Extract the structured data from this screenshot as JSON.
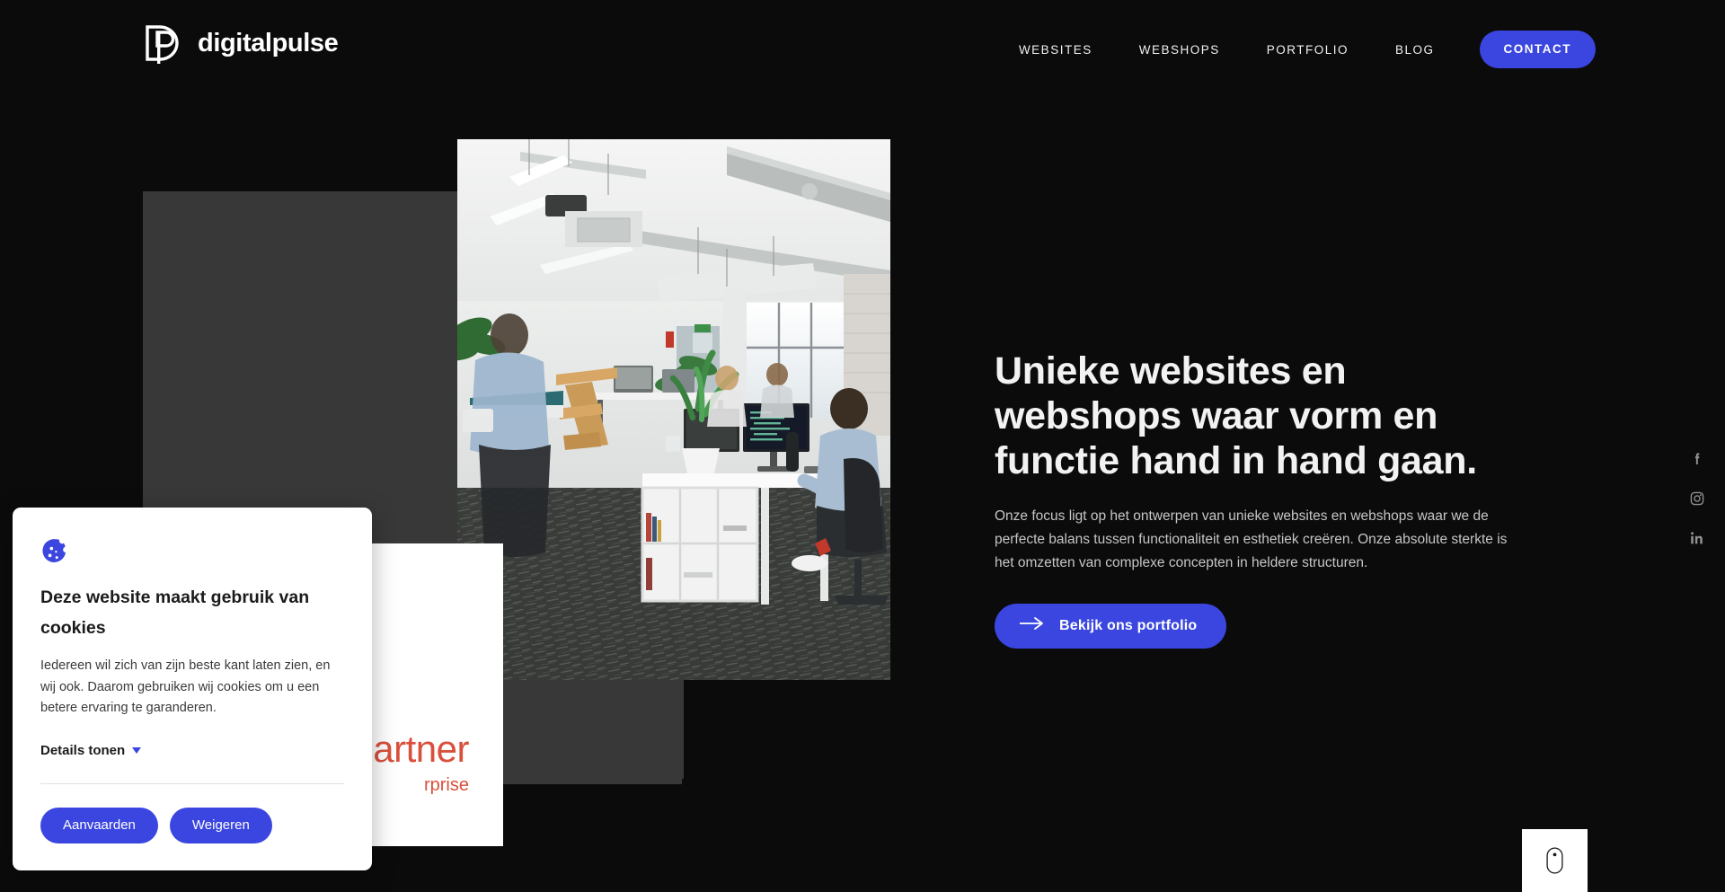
{
  "header": {
    "brand": {
      "name": "digitalpulse",
      "logo_icon": "dp-monogram-icon"
    },
    "nav": [
      {
        "label": "WEBSITES"
      },
      {
        "label": "WEBSHOPS"
      },
      {
        "label": "PORTFOLIO"
      },
      {
        "label": "BLOG"
      }
    ],
    "contact_label": "CONTACT"
  },
  "hero": {
    "title": "Unieke websites en webshops waar vorm en functie hand in hand gaan.",
    "paragraph": "Onze focus ligt op het ontwerpen van unieke websites en webshops waar we de perfecte balans tussen functionaliteit en esthetiek creëren. Onze absolute sterkte is het omzetten van complexe concepten in heldere structuren.",
    "cta_label": "Bekijk ons portfolio",
    "cta_icon": "arrow-right-icon",
    "photo_alt": "modern open-plan kantoor met medewerkers achter bureaus"
  },
  "partner_badge": {
    "title": "artner",
    "subtitle": "rprise"
  },
  "social": [
    {
      "name": "facebook",
      "icon": "facebook-icon"
    },
    {
      "name": "instagram",
      "icon": "instagram-icon"
    },
    {
      "name": "linkedin",
      "icon": "linkedin-icon"
    }
  ],
  "scroll_indicator": {
    "icon": "mouse-scroll-icon"
  },
  "cookie_banner": {
    "icon": "cookie-icon",
    "title": "Deze website maakt gebruik van cookies",
    "text": "Iedereen wil zich van zijn beste kant laten zien, en wij ook. Daarom gebruiken wij cookies om u een betere ervaring te garanderen.",
    "details_label": "Details tonen",
    "details_icon": "chevron-down-icon",
    "accept_label": "Aanvaarden",
    "decline_label": "Weigeren"
  },
  "colors": {
    "background": "#0b0b0b",
    "accent_blue": "#3b46e0",
    "gray_block": "#383838",
    "partner_red": "#d9503c",
    "card_white": "#ffffff"
  }
}
